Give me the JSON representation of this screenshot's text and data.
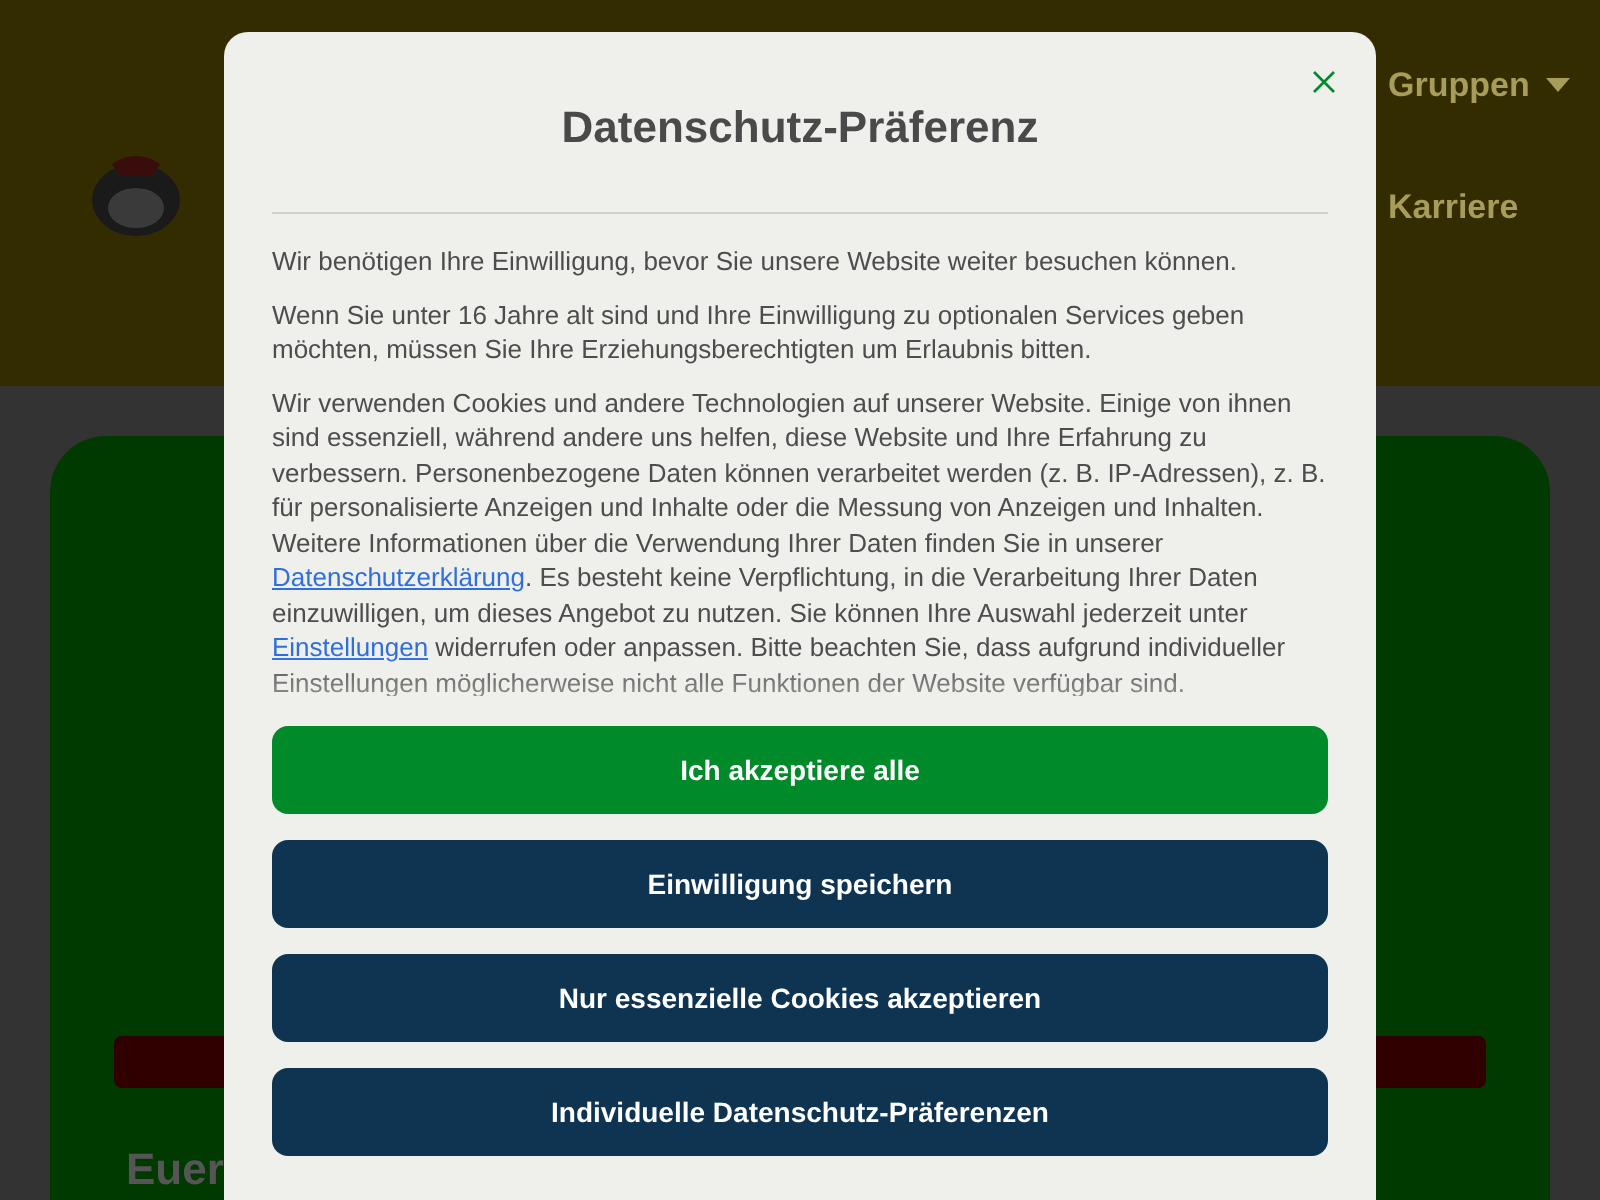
{
  "nav": [
    {
      "label": "Gruppen",
      "has_menu": true
    },
    {
      "label": "Karriere",
      "has_menu": false
    }
  ],
  "hero": {
    "subtitle": "Euer"
  },
  "dialog": {
    "title": "Datenschutz-Präferenz",
    "paragraphs": [
      {
        "parts": [
          {
            "kind": "text",
            "text": "Wir benötigen Ihre Einwilligung, bevor Sie unsere Website weiter besuchen können."
          }
        ]
      },
      {
        "parts": [
          {
            "kind": "text",
            "text": "Wenn Sie unter 16 Jahre alt sind und Ihre Einwilligung zu optionalen Services geben möchten, müssen Sie Ihre Erziehungsberechtigten um Erlaubnis bitten."
          }
        ]
      },
      {
        "parts": [
          {
            "kind": "text",
            "text": "Wir verwenden Cookies und andere Technologien auf unserer Website. Einige von ihnen sind essenziell, während andere uns helfen, diese Website und Ihre Erfahrung zu verbessern. Personenbezogene Daten können verarbeitet werden (z. B. IP-Adressen), z. B. für personalisierte Anzeigen und Inhalte oder die Messung von Anzeigen und Inhalten. Weitere Informationen über die Verwendung Ihrer Daten finden Sie in unserer "
          },
          {
            "kind": "link",
            "text": "Datenschutzerklärung"
          },
          {
            "kind": "text",
            "text": ". Es besteht keine Verpflichtung, in die Verarbeitung Ihrer Daten einzuwilligen, um dieses Angebot zu nutzen. Sie können Ihre Auswahl jederzeit unter "
          },
          {
            "kind": "link",
            "text": "Einstellungen"
          },
          {
            "kind": "text",
            "text": " widerrufen oder anpassen. Bitte beachten Sie, dass aufgrund individueller Einstellungen möglicherweise nicht alle Funktionen der Website verfügbar sind."
          }
        ]
      }
    ],
    "buttons": [
      {
        "label": "Ich akzeptiere alle",
        "kind": "primary"
      },
      {
        "label": "Einwilligung speichern",
        "kind": "secondary"
      },
      {
        "label": "Nur essenzielle Cookies akzeptieren",
        "kind": "secondary"
      },
      {
        "label": "Individuelle Datenschutz-Präferenzen",
        "kind": "secondary"
      }
    ]
  }
}
